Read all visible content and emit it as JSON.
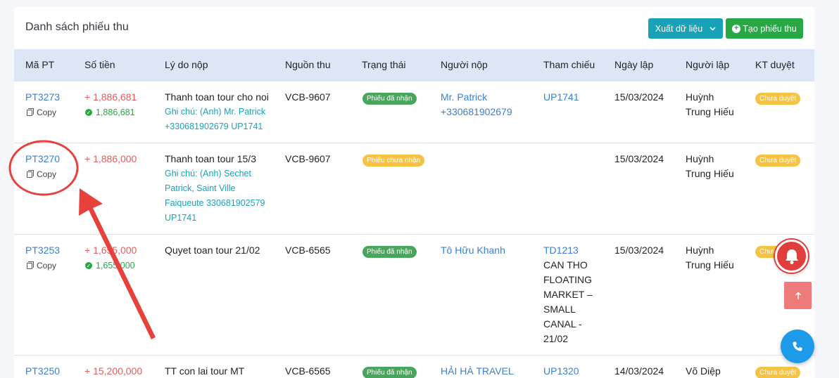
{
  "header": {
    "title": "Danh sách phiếu thu",
    "export_label": "Xuất dữ liệu",
    "create_label": "Tạo phiếu thu"
  },
  "columns": [
    "Mã PT",
    "Số tiền",
    "Lý do nộp",
    "Nguồn thu",
    "Trạng thái",
    "Người nộp",
    "Tham chiếu",
    "Ngày lập",
    "Người lập",
    "KT duyệt"
  ],
  "rows": [
    {
      "code": "PT3273",
      "copy": "Copy",
      "amount": "+ 1,886,681",
      "amount_received": "1,886,681",
      "reason": "Thanh toan tour cho noi",
      "note_lines": [
        "Ghi chú: (Anh) Mr. Patrick",
        "+330681902679 UP1741"
      ],
      "source": "VCB-9607",
      "status": "Phiếu đã nhận",
      "payer_lines": [
        "Mr. Patrick",
        "+330681902679"
      ],
      "reference_lines": [
        "UP1741"
      ],
      "date": "15/03/2024",
      "creator_lines": [
        "Huỳnh",
        "Trung Hiếu"
      ],
      "approval": "Chưa duyệt"
    },
    {
      "code": "PT3270",
      "copy": "Copy",
      "amount": "+ 1,886,000",
      "reason": "Thanh toan tour 15/3",
      "note_lines": [
        "Ghi chú: (Anh) Sechet",
        "Patrick, Saint Ville",
        "Faiqueute 330681902579",
        "UP1741"
      ],
      "source": "VCB-9607",
      "status": "Phiếu chưa nhận",
      "date": "15/03/2024",
      "creator_lines": [
        "Huỳnh",
        "Trung Hiếu"
      ],
      "approval": "Chưa duyệt"
    },
    {
      "code": "PT3253",
      "copy": "Copy",
      "amount": "+ 1,655,000",
      "amount_received": "1,655,000",
      "reason": "Quyet toan tour 21/02",
      "source": "VCB-6565",
      "status": "Phiếu đã nhận",
      "payer_lines": [
        "Tô Hữu Khanh"
      ],
      "reference_lines": [
        "TD1213"
      ],
      "reference_detail_lines": [
        "CAN THO",
        "FLOATING",
        "MARKET –",
        "SMALL",
        "CANAL -",
        "21/02"
      ],
      "date": "15/03/2024",
      "creator_lines": [
        "Huỳnh",
        "Trung Hiếu"
      ],
      "approval": "Chưa duyệt"
    },
    {
      "code": "PT3250",
      "amount": "+ 15,200,000",
      "reason": "TT con lai tour MT",
      "source": "VCB-6565",
      "status": "Phiếu đã nhận",
      "payer_lines": [
        "HẢI HÀ TRAVEL"
      ],
      "reference_lines": [
        "UP1320"
      ],
      "date": "14/03/2024",
      "creator_lines": [
        "Võ Diệp"
      ],
      "approval": "Chưa duyệt"
    }
  ],
  "colors": {
    "link": "#3c7fd0",
    "amount": "#e35d5d",
    "received": "#28a745",
    "note": "#17a2b8",
    "header_bg": "#dce6f7",
    "annotation": "#e8413c"
  },
  "icons": [
    "copy-icon",
    "check-circle-icon",
    "plus-circle-icon",
    "chevron-down-icon",
    "bell-icon",
    "arrow-up-icon",
    "phone-icon"
  ]
}
